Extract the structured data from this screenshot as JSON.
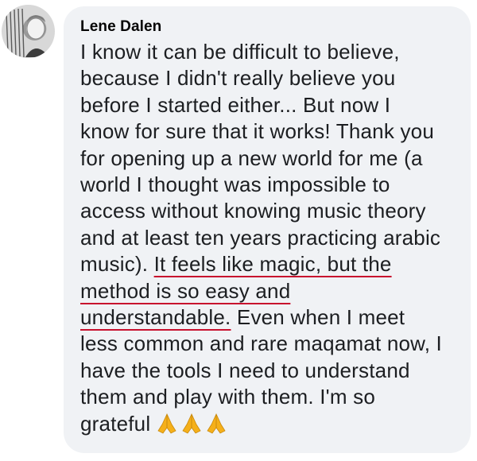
{
  "comment": {
    "author": "Lene Dalen",
    "lines": [
      "I know it can be difficult to believe,",
      "because I didn't really believe you",
      "before I started either... But now I",
      "know for sure that it works! Thank you",
      "for opening up a new world for me (a",
      "world I thought was impossible to",
      "access without knowing music theory",
      "and at least ten years practicing arabic"
    ],
    "line9_plain": "music). ",
    "line9_highlight": "It feels like magic, but the",
    "line10_highlight": "method is so easy and",
    "line11_highlight": "understandable.",
    "line11_plain": " Even when I meet",
    "lines_after": [
      "less common and rare maqamat now, I",
      "have the tools I need to understand",
      "them and play with them. I'm so"
    ],
    "last_line": "grateful",
    "emojis": [
      "folded-hands-icon",
      "folded-hands-icon",
      "folded-hands-icon"
    ]
  },
  "colors": {
    "bubble_bg": "#f0f2f5",
    "text": "#1c1e21",
    "underline": "#c8102e",
    "emoji": "#f5b01a"
  }
}
